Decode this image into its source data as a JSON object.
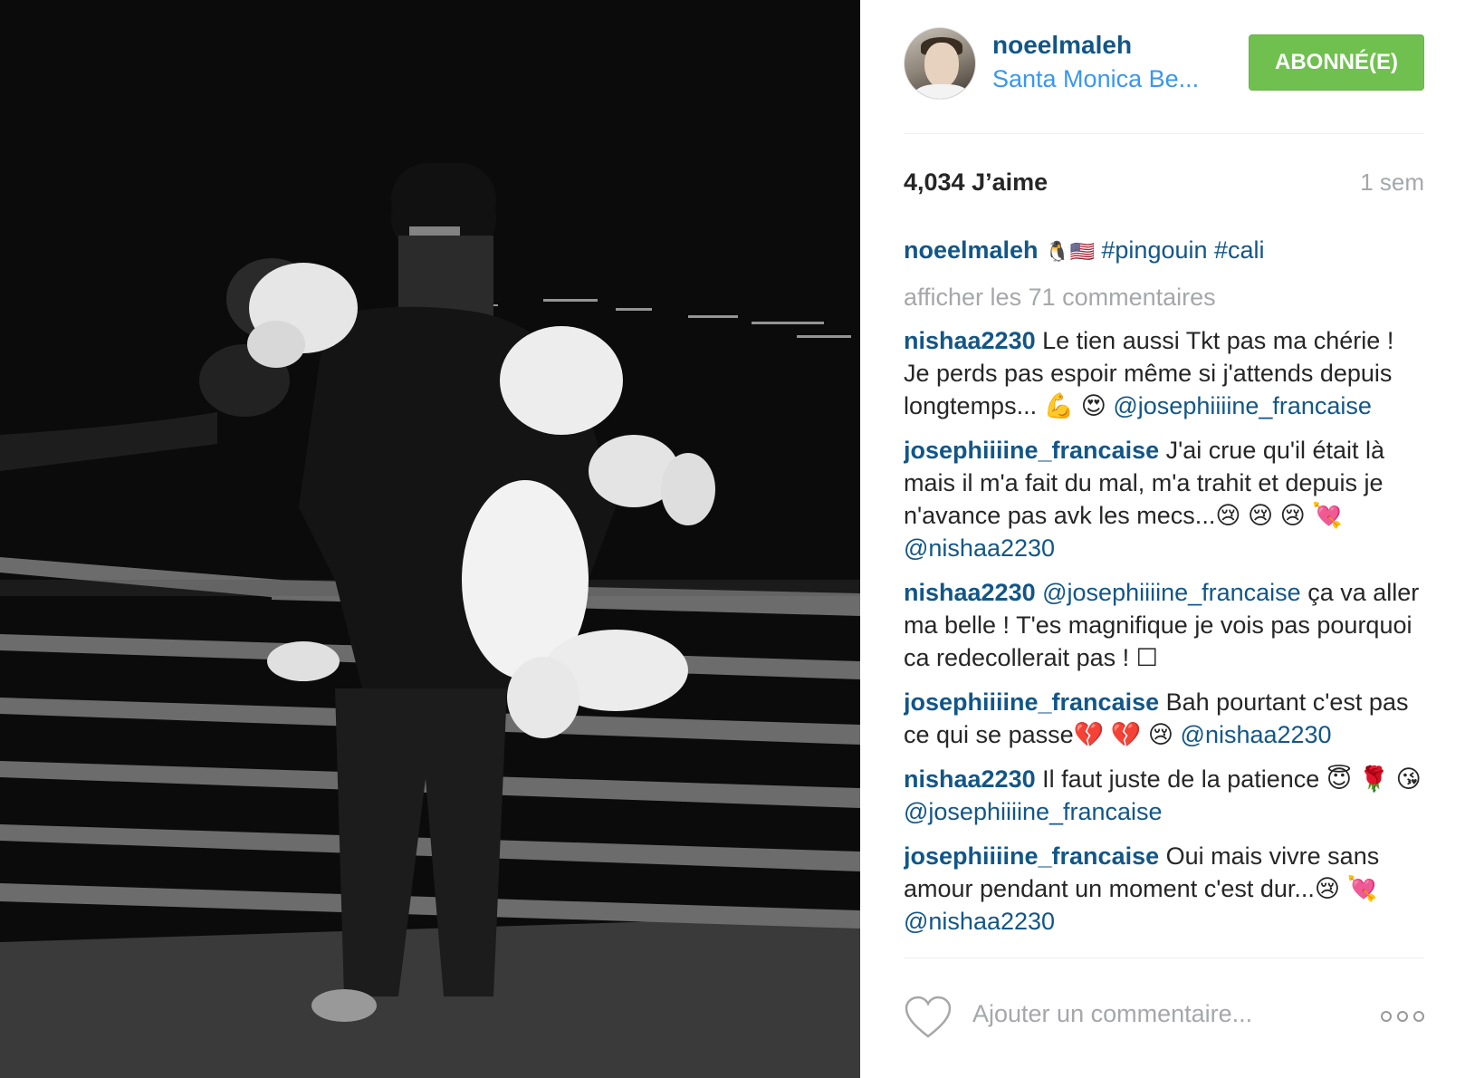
{
  "post": {
    "username": "noeelmaleh",
    "location": "Santa Monica Be...",
    "follow_label": "ABONNÉ(E)",
    "likes": "4,034 J’aime",
    "age": "1 sem",
    "caption_emoji": "🐧🇺🇸",
    "caption_tags": "#pingouin #cali",
    "view_all": "afficher les 71 commentaires",
    "add_comment_placeholder": "Ajouter un commentaire..."
  },
  "comments": [
    {
      "user": "nishaa2230",
      "text": "Le tien aussi Tkt pas ma chérie ! Je perds pas espoir même si j'attends depuis longtemps... 💪 😍",
      "mention": "@josephiiiine_francaise"
    },
    {
      "user": "josephiiiine_francaise",
      "text": "J'ai crue qu'il était là mais il m'a fait du mal, m'a trahit et depuis je n'avance pas avk les mecs...😢 😢 😢 💘",
      "mention": "@nishaa2230"
    },
    {
      "user": "nishaa2230",
      "mention": "@josephiiiine_francaise",
      "text": "ça va aller ma belle ! T'es magnifique je vois pas pourquoi ca redecollerait pas ! ☐"
    },
    {
      "user": "josephiiiine_francaise",
      "text": "Bah pourtant c'est pas ce qui se passe💔 💔 😢",
      "mention": "@nishaa2230"
    },
    {
      "user": "nishaa2230",
      "text": "Il faut juste de la patience 😇 🌹 😘",
      "mention": "@josephiiiine_francaise"
    },
    {
      "user": "josephiiiine_francaise",
      "text": "Oui mais vivre sans amour pendant un moment c'est dur...😢",
      "mention": "💘 @nishaa2230"
    }
  ],
  "icons": {
    "like": "heart-outline-icon",
    "more": "more-options-icon"
  },
  "colors": {
    "username": "#125688",
    "location": "#3897f0",
    "follow_button": "#70c050",
    "muted_text": "#a5a7aa"
  }
}
